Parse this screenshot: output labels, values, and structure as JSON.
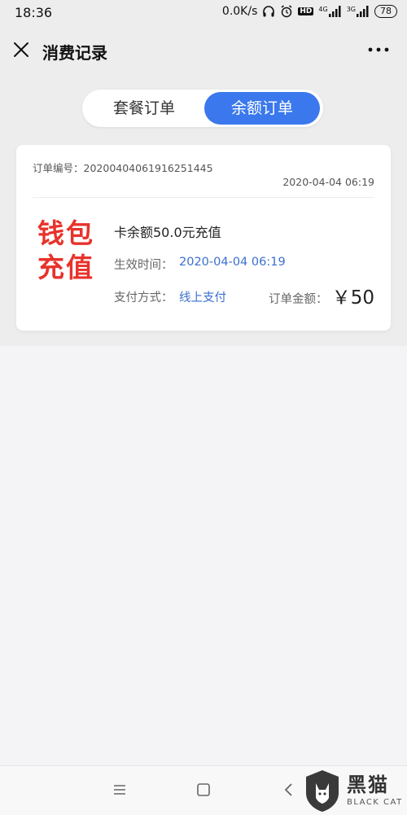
{
  "status_bar": {
    "time": "18:36",
    "net_speed": "0.0K/s",
    "hd": "HD",
    "net1": "4G",
    "net2": "3G",
    "battery": "78"
  },
  "header": {
    "title": "消费记录"
  },
  "tabs": [
    {
      "label": "套餐订单",
      "active": false
    },
    {
      "label": "余额订单",
      "active": true
    }
  ],
  "order": {
    "number_label": "订单编号：",
    "number": "20200404061916251445",
    "time": "2020-04-04 06:19",
    "logo_line1": "钱包",
    "logo_line2": "充值",
    "item_title": "卡余额50.0元充值",
    "effective_label": "生效时间：",
    "effective_value": "2020-04-04 06:19",
    "payment_label": "支付方式：",
    "payment_value": "线上支付",
    "amount_label": "订单金额：",
    "amount_value": "￥50"
  },
  "watermark": {
    "cn": "黑猫",
    "en": "BLACK CAT"
  },
  "colors": {
    "accent": "#3b78ed",
    "link": "#3b6fd0",
    "logo_red": "#e8322b"
  }
}
